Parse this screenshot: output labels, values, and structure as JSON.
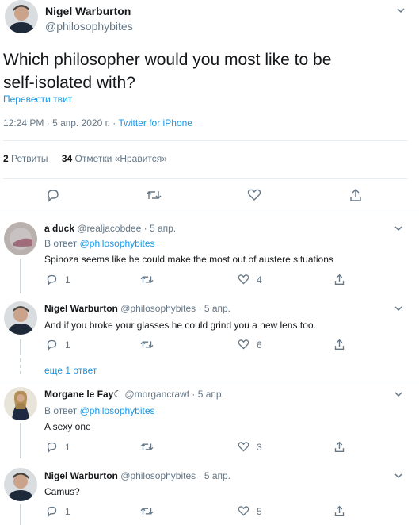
{
  "main_tweet": {
    "author_name": "Nigel Warburton",
    "author_handle": "@philosophybites",
    "text_line1": "Which philosopher would you most like to be",
    "text_line2": "self-isolated with?",
    "translate": "Перевести твит",
    "time": "12:24 PM",
    "dot": "·",
    "date": "5 апр. 2020 г.",
    "source": "Twitter for iPhone",
    "retweets_count": "2",
    "retweets_label": "Ретвиты",
    "likes_count": "34",
    "likes_label": "Отметки «Нравится»"
  },
  "replies": [
    {
      "name": "a duck",
      "handle": "@realjacobdee",
      "date": "5 апр.",
      "reply_to_prefix": "В ответ",
      "reply_to_handle": "@philosophybites",
      "text": "Spinoza seems like he could make the most out of austere situations",
      "replies": "1",
      "likes": "4"
    },
    {
      "name": "Nigel Warburton",
      "handle": "@philosophybites",
      "date": "5 апр.",
      "text": "And if you broke your glasses he could grind you a new lens too.",
      "replies": "1",
      "likes": "6",
      "more_replies": "еще 1 ответ"
    },
    {
      "name": "Morgane le Fay☾",
      "handle": "@morgancrawf",
      "date": "5 апр.",
      "reply_to_prefix": "В ответ",
      "reply_to_handle": "@philosophybites",
      "text": "A sexy one",
      "replies": "1",
      "likes": "3"
    },
    {
      "name": "Nigel Warburton",
      "handle": "@philosophybites",
      "date": "5 апр.",
      "text": "Camus?",
      "replies": "1",
      "likes": "5"
    }
  ],
  "dot": "·",
  "colors": {
    "accent": "#1b95e0",
    "secondary": "#657786",
    "border": "#e6ecf0",
    "thread": "#ccd6dd"
  },
  "icons": [
    "reply-icon",
    "retweet-icon",
    "like-icon",
    "share-icon",
    "chevron-down-icon"
  ]
}
